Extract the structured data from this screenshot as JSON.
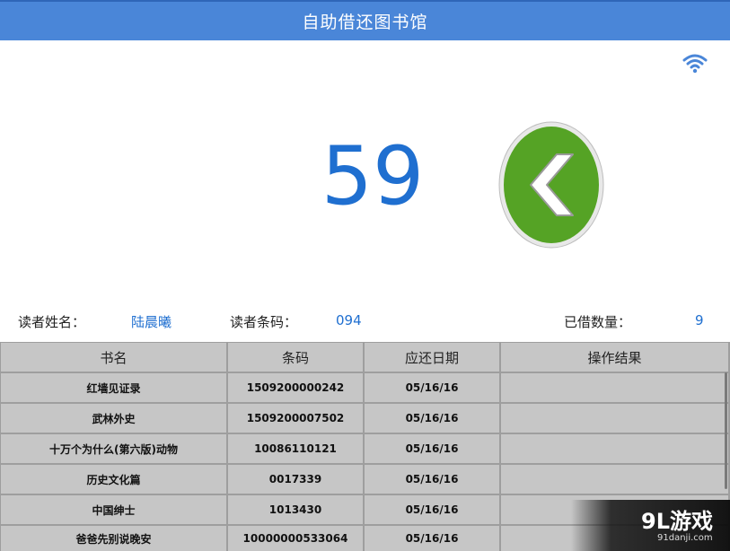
{
  "header": {
    "title": "自助借还图书馆"
  },
  "status": {
    "wifi_icon": "wifi-icon"
  },
  "countdown": {
    "value": "59"
  },
  "back_button": {
    "icon": "back-arrow-icon",
    "color": "#55a325"
  },
  "reader": {
    "name_label": "读者姓名：",
    "name_value": "陆晨曦",
    "barcode_label": "读者条码：",
    "barcode_value": "094",
    "borrowed_label": "已借数量：",
    "borrowed_value": "9"
  },
  "table": {
    "headers": [
      "书名",
      "条码",
      "应还日期",
      "操作结果"
    ],
    "rows": [
      {
        "title": "红墙见证录",
        "barcode": "1509200000242",
        "due": "05/16/16",
        "result": ""
      },
      {
        "title": "武林外史",
        "barcode": "1509200007502",
        "due": "05/16/16",
        "result": ""
      },
      {
        "title": "十万个为什么(第六版)动物",
        "barcode": "10086110121",
        "due": "05/16/16",
        "result": ""
      },
      {
        "title": "历史文化篇",
        "barcode": "0017339",
        "due": "05/16/16",
        "result": ""
      },
      {
        "title": "中国绅士",
        "barcode": "1013430",
        "due": "05/16/16",
        "result": ""
      },
      {
        "title": "爸爸先别说晚安",
        "barcode": "10000000533064",
        "due": "05/16/16",
        "result": ""
      }
    ]
  },
  "watermark": {
    "logo": "9L游戏",
    "url": "91danji.com"
  }
}
